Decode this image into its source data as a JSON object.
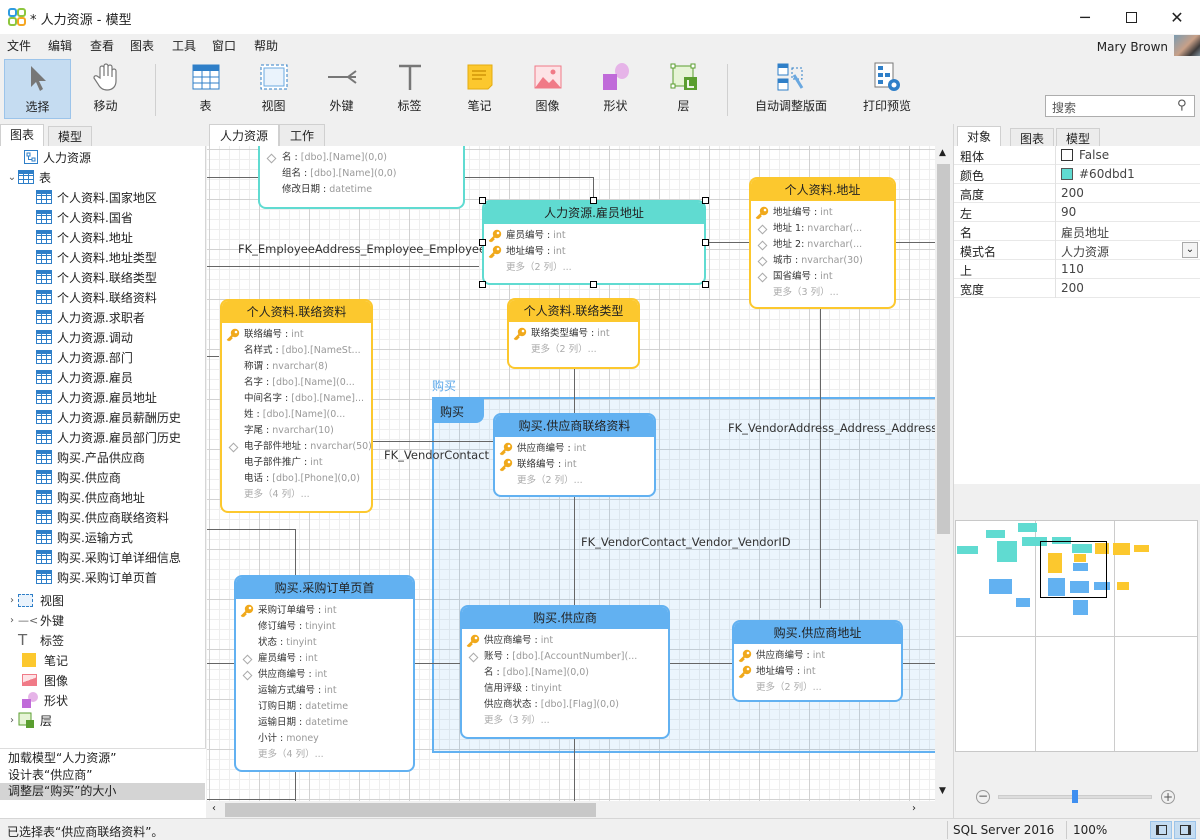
{
  "window": {
    "title": "* 人力资源 - 模型",
    "minimize_icon": "minimize-icon",
    "maximize_icon": "maximize-icon",
    "close_icon": "close-icon"
  },
  "menu": [
    "文件",
    "编辑",
    "查看",
    "图表",
    "工具",
    "窗口",
    "帮助"
  ],
  "user": {
    "name": "Mary Brown"
  },
  "toolbar": {
    "tools": [
      {
        "label": "选择",
        "icon": "pointer-icon",
        "active": true
      },
      {
        "label": "移动",
        "icon": "hand-icon"
      },
      {
        "label": "表",
        "icon": "table-icon"
      },
      {
        "label": "视图",
        "icon": "view-icon"
      },
      {
        "label": "外键",
        "icon": "foreign-key-icon"
      },
      {
        "label": "标签",
        "icon": "label-icon"
      },
      {
        "label": "笔记",
        "icon": "note-icon"
      },
      {
        "label": "图像",
        "icon": "image-icon"
      },
      {
        "label": "形状",
        "icon": "shape-icon"
      },
      {
        "label": "层",
        "icon": "layer-icon"
      },
      {
        "label": "自动调整版面",
        "icon": "auto-layout-icon"
      },
      {
        "label": "打印预览",
        "icon": "print-preview-icon"
      }
    ],
    "search_placeholder": "搜索"
  },
  "left_panel": {
    "tabs": [
      "图表",
      "模型"
    ],
    "diagram_root": "人力资源",
    "tables_group": "表",
    "tables": [
      "个人资料.国家地区",
      "个人资料.国省",
      "个人资料.地址",
      "个人资料.地址类型",
      "个人资料.联络类型",
      "个人资料.联络资料",
      "人力资源.求职者",
      "人力资源.调动",
      "人力资源.部门",
      "人力资源.雇员",
      "人力资源.雇员地址",
      "人力资源.雇员薪酬历史",
      "人力资源.雇员部门历史",
      "购买.产品供应商",
      "购买.供应商",
      "购买.供应商地址",
      "购买.供应商联络资料",
      "购买.运输方式",
      "购买.采购订单详细信息",
      "购买.采购订单页首"
    ],
    "groups": [
      "视图",
      "外键",
      "标签",
      "笔记",
      "图像",
      "形状",
      "层"
    ],
    "history": [
      "加载模型“人力资源”",
      "设计表“供应商”",
      "调整层“购买”的大小"
    ]
  },
  "canvas": {
    "tabs": [
      "人力资源",
      "工作"
    ],
    "layer_name": "购买",
    "layer_caption": "购买",
    "fk_labels": [
      "FK_EmployeeAddress_Employee_EmployeeID",
      "FK_VendorContact",
      "FK_VendorAddress_Address_AddressID",
      "FK_VendorContact_Vendor_VendorID"
    ],
    "entities": {
      "partial_top": {
        "rows": [
          {
            "n": "名 : ",
            "t": "[dbo].[Name](0,0)",
            "i": "dia"
          },
          {
            "n": "组名 : ",
            "t": "[dbo].[Name](0,0)"
          },
          {
            "n": "修改日期 : ",
            "t": "datetime"
          }
        ]
      },
      "emp_addr": {
        "title": "人力资源.雇员地址",
        "rows": [
          {
            "n": "雇员编号 : ",
            "t": "int",
            "i": "key"
          },
          {
            "n": "地址编号 : ",
            "t": "int",
            "i": "key"
          }
        ],
        "more": "更多（2 列）..."
      },
      "address": {
        "title": "个人资料.地址",
        "rows": [
          {
            "n": "地址编号 : ",
            "t": "int",
            "i": "key"
          },
          {
            "n": "地址 1: ",
            "t": "nvarchar(...",
            "i": "dia"
          },
          {
            "n": "地址 2: ",
            "t": "nvarchar(...",
            "i": "dia"
          },
          {
            "n": "城市 : ",
            "t": "nvarchar(30)",
            "i": "dia"
          },
          {
            "n": "国省编号 : ",
            "t": "int",
            "i": "dia"
          }
        ],
        "more": "更多（3 列）..."
      },
      "contact": {
        "title": "个人资料.联络资料",
        "rows": [
          {
            "n": "联络编号 : ",
            "t": "int",
            "i": "key"
          },
          {
            "n": "名样式 : ",
            "t": "[dbo].[NameSt..."
          },
          {
            "n": "称谓 : ",
            "t": "nvarchar(8)"
          },
          {
            "n": "名字 : ",
            "t": "[dbo].[Name](0..."
          },
          {
            "n": "中间名字 : ",
            "t": "[dbo].[Name]..."
          },
          {
            "n": "姓 : ",
            "t": "[dbo].[Name](0..."
          },
          {
            "n": "字尾 : ",
            "t": "nvarchar(10)"
          },
          {
            "n": "电子部件地址 : ",
            "t": "nvarchar(50)",
            "i": "dia"
          },
          {
            "n": "电子部件推广 : ",
            "t": "int"
          },
          {
            "n": "电话 : ",
            "t": "[dbo].[Phone](0,0)"
          }
        ],
        "more": "更多（4 列）..."
      },
      "contact_type": {
        "title": "个人资料.联络类型",
        "rows": [
          {
            "n": "联络类型编号 : ",
            "t": "int",
            "i": "key"
          }
        ],
        "more": "更多（2 列）..."
      },
      "vendor_contact": {
        "title": "购买.供应商联络资料",
        "rows": [
          {
            "n": "供应商编号 : ",
            "t": "int",
            "i": "key"
          },
          {
            "n": "联络编号 : ",
            "t": "int",
            "i": "key"
          }
        ],
        "more": "更多（2 列）..."
      },
      "po_header": {
        "title": "购买.采购订单页首",
        "rows": [
          {
            "n": "采购订单编号 : ",
            "t": "int",
            "i": "key"
          },
          {
            "n": "修订编号 : ",
            "t": "tinyint"
          },
          {
            "n": "状态 : ",
            "t": "tinyint"
          },
          {
            "n": "雇员编号 : ",
            "t": "int",
            "i": "dia"
          },
          {
            "n": "供应商编号 : ",
            "t": "int",
            "i": "dia"
          },
          {
            "n": "运输方式编号 : ",
            "t": "int"
          },
          {
            "n": "订购日期 : ",
            "t": "datetime"
          },
          {
            "n": "运输日期 : ",
            "t": "datetime"
          },
          {
            "n": "小计 : ",
            "t": "money"
          }
        ],
        "more": "更多（4 列）..."
      },
      "vendor": {
        "title": "购买.供应商",
        "rows": [
          {
            "n": "供应商编号 : ",
            "t": "int",
            "i": "key"
          },
          {
            "n": "账号 : ",
            "t": "[dbo].[AccountNumber](...",
            "i": "dia"
          },
          {
            "n": "名 : ",
            "t": "[dbo].[Name](0,0)"
          },
          {
            "n": "信用评级 : ",
            "t": "tinyint"
          },
          {
            "n": "供应商状态 : ",
            "t": "[dbo].[Flag](0,0)"
          }
        ],
        "more": "更多（3 列）..."
      },
      "vendor_addr": {
        "title": "购买.供应商地址",
        "rows": [
          {
            "n": "供应商编号 : ",
            "t": "int",
            "i": "key"
          },
          {
            "n": "地址编号 : ",
            "t": "int",
            "i": "key"
          }
        ],
        "more": "更多（2 列）..."
      }
    }
  },
  "right_panel": {
    "tabs": [
      "对象",
      "图表",
      "模型"
    ],
    "properties": [
      {
        "key": "粗体",
        "value": "False"
      },
      {
        "key": "颜色",
        "value": "#60dbd1"
      },
      {
        "key": "高度",
        "value": "200"
      },
      {
        "key": "左",
        "value": "90"
      },
      {
        "key": "名",
        "value": "雇员地址"
      },
      {
        "key": "模式名",
        "value": "人力资源"
      },
      {
        "key": "上",
        "value": "110"
      },
      {
        "key": "宽度",
        "value": "200"
      }
    ],
    "zoom_slider": 0.5
  },
  "colors": {
    "teal": "#60dbd1",
    "yellow": "#fcc82e",
    "blue": "#62b1f1"
  },
  "status": {
    "message": "已选择表“供应商联络资料”。",
    "db": "SQL Server 2016",
    "zoom": "100%"
  }
}
